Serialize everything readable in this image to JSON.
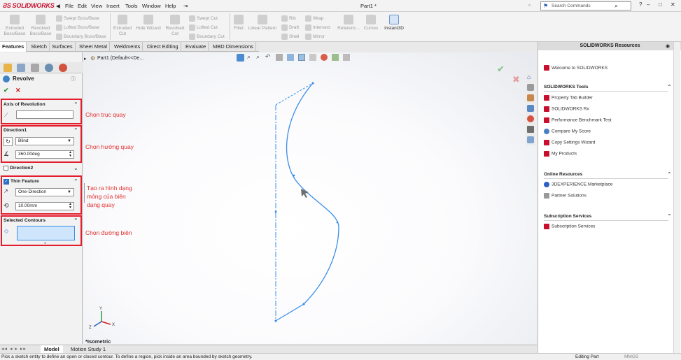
{
  "app": {
    "logo_text": "SOLIDWORKS",
    "doc_title": "Part1 *"
  },
  "menu": [
    "File",
    "Edit",
    "View",
    "Insert",
    "Tools",
    "Window",
    "Help"
  ],
  "search": {
    "placeholder": "Search Commands"
  },
  "cmd": {
    "extruded_boss": "Extruded Boss/Base",
    "revolved_boss": "Revolved Boss/Base",
    "swept_boss": "Swept Boss/Base",
    "lofted_boss": "Lofted Boss/Base",
    "boundary_boss": "Boundary Boss/Base",
    "extruded_cut": "Extruded Cut",
    "hole_wizard": "Hole Wizard",
    "revolved_cut": "Revolved Cut",
    "swept_cut": "Swept Cut",
    "lofted_cut": "Lofted Cut",
    "boundary_cut": "Boundary Cut",
    "fillet": "Fillet",
    "linear_pattern": "Linear Pattern",
    "rib": "Rib",
    "draft": "Draft",
    "shell": "Shell",
    "wrap": "Wrap",
    "intersect": "Intersect",
    "mirror": "Mirror",
    "reference": "Referenc...",
    "curves": "Curves",
    "instant3d": "Instant3D"
  },
  "tabs": [
    "Features",
    "Sketch",
    "Surfaces",
    "Sheet Metal",
    "Weldments",
    "Direct Editing",
    "Evaluate",
    "MBD Dimensions"
  ],
  "tree_item": "Part1  (Default<<De...",
  "prop": {
    "title": "Revolve",
    "axis_title": "Axis of Revolution",
    "dir1_title": "Direction1",
    "dir1_type": "Blind",
    "dir1_angle": "360.00deg",
    "dir2_title": "Direction2",
    "thin_title": "Thin Feature",
    "thin_type": "One-Direction",
    "thin_value": "10.00mm",
    "contours_title": "Selected Contours"
  },
  "annotations": {
    "axis": "Chọn trục quay",
    "direction": "Chọn hướng quay",
    "thin_line1": "Tạo ra hình dạng",
    "thin_line2": "mỏng của biên",
    "thin_line3": "dạng quay",
    "contour": "Chọn đường biên"
  },
  "view": {
    "orientation": "*Isometric"
  },
  "bottom_tabs": [
    "Model",
    "Motion Study 1"
  ],
  "status": {
    "message": "Pick a sketch entity to define an open or closed contour. To define a region, pick inside an area bounded by sketch geometry.",
    "mode": "Editing Part",
    "units": "MMGS"
  },
  "resources": {
    "title": "SOLIDWORKS Resources",
    "welcome": "Welcome to SOLIDWORKS",
    "tools_title": "SOLIDWORKS Tools",
    "tools": [
      "Property Tab Builder",
      "SOLIDWORKS Rx",
      "Performance Benchmark Test",
      "Compare My Score",
      "Copy Settings Wizard",
      "My Products"
    ],
    "online_title": "Online Resources",
    "online": [
      "3DEXPERIENCE Marketplace",
      "Partner Solutions"
    ],
    "sub_title": "Subscription Services",
    "sub": [
      "Subscription Services"
    ]
  },
  "colors": {
    "accent_red": "#e41d2d",
    "sketch_blue": "#3a8ee6",
    "annotation_red": "#e0302e"
  }
}
